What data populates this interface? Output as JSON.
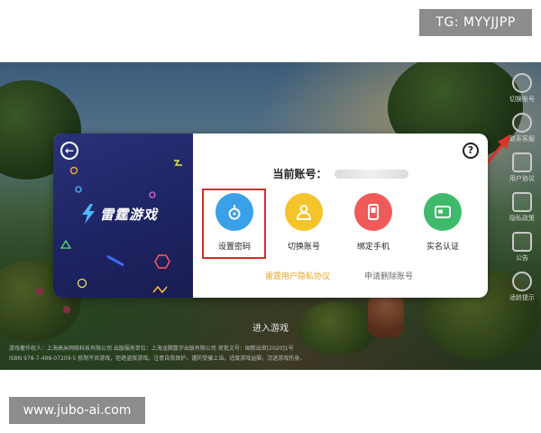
{
  "watermark_top": "TG: MYYJJPP",
  "watermark_bottom": "www.jubo-ai.com",
  "game": {
    "enter_label": "进入游戏",
    "footer_line1": "游戏著作权人：上海高米网络科技有限公司  出版服务单位：上海龙腾数字出版有限公司  审批文号：国新出审[2020]1号",
    "footer_line2": "ISBN 978-7-498-07209-5  抵制不良游戏，拒绝盗版游戏。注意自我保护，谨防受骗上当。适度游戏益脑，沉迷游戏伤身。"
  },
  "side_rail": [
    {
      "label": "切换账号",
      "icon": "switch-account-icon"
    },
    {
      "label": "联系客服",
      "icon": "customer-service-icon"
    },
    {
      "label": "用户协议",
      "icon": "user-agreement-icon"
    },
    {
      "label": "隐私政策",
      "icon": "privacy-policy-icon"
    },
    {
      "label": "公告",
      "icon": "announcement-icon"
    },
    {
      "label": "适龄提示",
      "icon": "age-rating-icon"
    }
  ],
  "dialog": {
    "brand": "雷霆游戏",
    "account_label": "当前账号：",
    "actions": [
      {
        "label": "设置密码",
        "icon": "lock-icon",
        "color": "#3aa0e8"
      },
      {
        "label": "切换账号",
        "icon": "user-icon",
        "color": "#f5c42a"
      },
      {
        "label": "绑定手机",
        "icon": "phone-icon",
        "color": "#f05a5a"
      },
      {
        "label": "实名认证",
        "icon": "id-card-icon",
        "color": "#3fba6a"
      }
    ],
    "privacy_link": "雷霆用户隐私协议",
    "delete_link": "申请删除账号",
    "help_icon": "question-icon",
    "back_icon": "back-arrow-icon"
  },
  "colors": {
    "highlight": "#d4302b",
    "privacy_link": "#e8a21b",
    "brand_panel": "#1e2463"
  }
}
